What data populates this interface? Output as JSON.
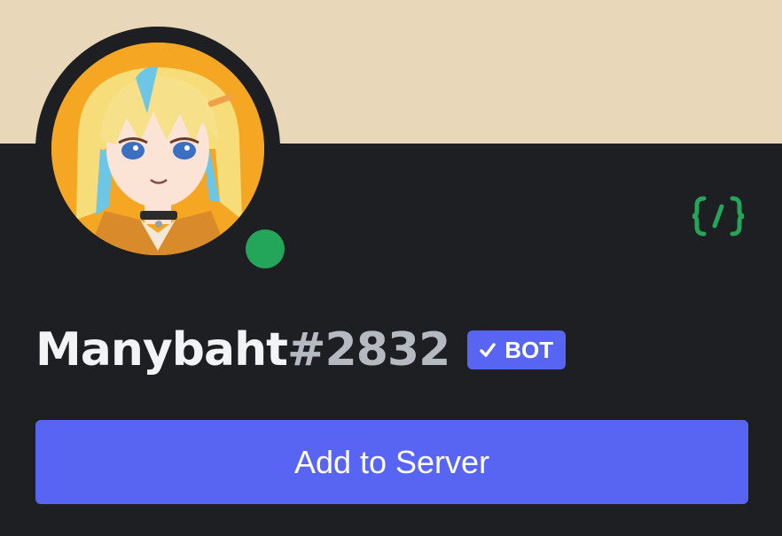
{
  "profile": {
    "username": "Manybaht",
    "discriminator": "#2832",
    "bot_tag_label": "BOT",
    "status": "online",
    "avatar_icon": "anime-avatar",
    "dev_badge_icon": "code-braces-icon",
    "add_button_label": "Add to Server"
  },
  "colors": {
    "banner": "#e8d7b9",
    "background": "#1e1f22",
    "blurple": "#5865f2",
    "online": "#23a55a",
    "username": "#f2f3f5",
    "discriminator": "#b5bac1",
    "dev_badge": "#23a55a"
  }
}
